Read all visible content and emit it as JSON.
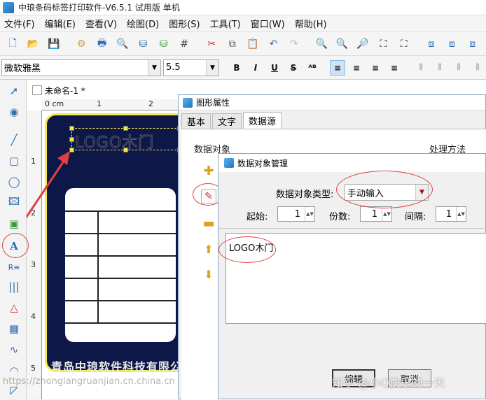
{
  "app": {
    "title": "中琅条码标签打印软件-V6.5.1 试用版 单机"
  },
  "menu": [
    "文件(F)",
    "编辑(E)",
    "查看(V)",
    "绘图(D)",
    "图形(S)",
    "工具(T)",
    "窗口(W)",
    "帮助(H)"
  ],
  "fontbar": {
    "font_name": "微软雅黑",
    "font_size": "5.5",
    "bold": "B",
    "italic": "I",
    "underline": "U",
    "strike": "S"
  },
  "document": {
    "tab_label": "未命名-1 *",
    "ruler_h": [
      "0 cm",
      "1",
      "2"
    ],
    "ruler_v": [
      "1",
      "2",
      "3",
      "4",
      "5"
    ]
  },
  "label": {
    "logo_text": "LOGO木门",
    "company": "青岛中琅软件科技有限公司"
  },
  "shape_props": {
    "title": "图形属性",
    "tabs": [
      "基本",
      "文字",
      "数据源"
    ],
    "section_data": "数据对象",
    "section_method": "处理方法"
  },
  "data_mgr": {
    "title": "数据对象管理",
    "type_label": "数据对象类型:",
    "type_value": "手动输入",
    "start_label": "起始:",
    "start_value": "1",
    "copies_label": "份数:",
    "copies_value": "1",
    "interval_label": "间隔:",
    "interval_value": "1",
    "content": "LOGO木门",
    "edit_button": "编辑",
    "cancel_button": "取消"
  },
  "watermarks": {
    "url": "https://zhonglangruanjian.cn.china.cn",
    "zhihu": "知乎 @小Q快乐的一天"
  },
  "colors": {
    "label_bg": "#0e1848",
    "label_border": "#f3e94a",
    "annotation_red": "#e04040"
  }
}
